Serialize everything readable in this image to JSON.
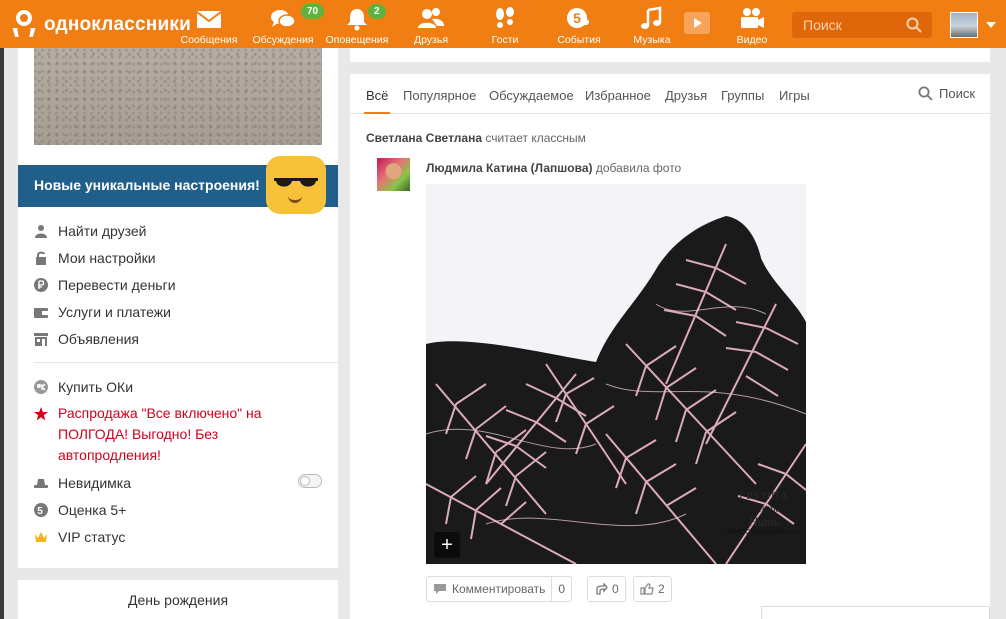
{
  "brand": {
    "name": "одноклассники",
    "accent": "#f07e13"
  },
  "nav": [
    {
      "id": "messages",
      "label": "Сообщения",
      "icon": "envelope-icon"
    },
    {
      "id": "discussions",
      "label": "Обсуждения",
      "icon": "chat-bubbles-icon",
      "badge": "70"
    },
    {
      "id": "notifications",
      "label": "Оповещения",
      "icon": "bell-icon",
      "badge": "2"
    },
    {
      "id": "friends",
      "label": "Друзья",
      "icon": "people-icon"
    },
    {
      "id": "guests",
      "label": "Гости",
      "icon": "footprints-icon"
    },
    {
      "id": "events",
      "label": "События",
      "icon": "five-plus-icon"
    },
    {
      "id": "music",
      "label": "Музыка",
      "icon": "music-note-icon"
    },
    {
      "id": "video",
      "label": "Видео",
      "icon": "camera-icon"
    }
  ],
  "search": {
    "placeholder": "Поиск"
  },
  "promo": {
    "text": "Новые уникальные настроения!"
  },
  "menu": [
    {
      "label": "Найти друзей",
      "icon": "person-icon"
    },
    {
      "label": "Мои настройки",
      "icon": "lock-icon"
    },
    {
      "label": "Перевести деньги",
      "icon": "ruble-coin-icon"
    },
    {
      "label": "Услуги и платежи",
      "icon": "wallet-icon"
    },
    {
      "label": "Объявления",
      "icon": "storefront-icon"
    }
  ],
  "menu2": {
    "buy_ok": "Купить ОКи",
    "sale": "Распродажа \"Все включено\" на ПОЛГОДА! Выгодно! Без автопродления!",
    "invisible": "Невидимка",
    "rating": "Оценка 5+",
    "vip": "VIP статус"
  },
  "birthday": {
    "title": "День рождения"
  },
  "tabs": [
    "Всё",
    "Популярное",
    "Обсуждаемое",
    "Избранное",
    "Друзья",
    "Группы",
    "Игры"
  ],
  "tab_search": "Поиск",
  "feed": {
    "liker": "Светлана Светлана",
    "liker_action": "считает классным",
    "author": "Людмила Катина (Лапшова)",
    "author_action": "добавила фото",
    "watermark": {
      "line1": "ГРУППА",
      "line2": "Сюжетная",
      "line3": "Нить",
      "line4": "ПРИСОЕДИНЯЙТЕСЬ!"
    },
    "comment_label": "Комментировать",
    "comment_count": "0",
    "share_count": "0",
    "like_count": "2"
  }
}
